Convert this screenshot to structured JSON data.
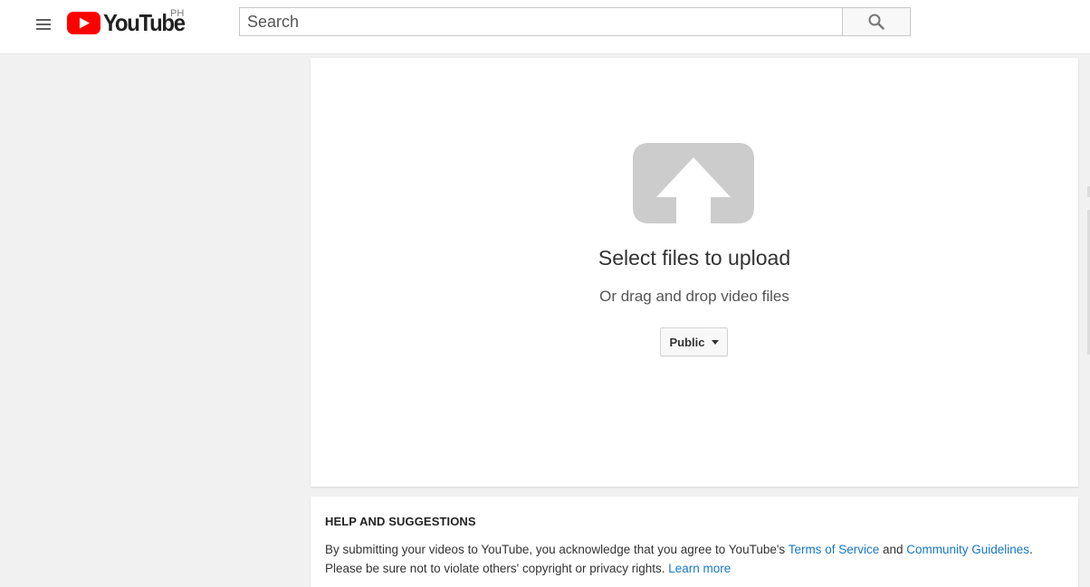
{
  "header": {
    "logo_text": "YouTube",
    "logo_region": "PH",
    "search_placeholder": "Search"
  },
  "upload": {
    "title": "Select files to upload",
    "subtitle": "Or drag and drop video files",
    "privacy_label": "Public"
  },
  "help": {
    "title": "HELP AND SUGGESTIONS",
    "line1_prefix": "By submitting your videos to YouTube, you acknowledge that you agree to YouTube's ",
    "terms_link": "Terms of Service",
    "line1_and": " and ",
    "guidelines_link": "Community Guidelines",
    "line1_end": ".",
    "line2_prefix": "Please be sure not to violate others' copyright or privacy rights. ",
    "learn_more_link": "Learn more"
  },
  "colors": {
    "brand_red": "#ff0000",
    "link_blue": "#167ac6",
    "upload_icon_gray": "#cccccc",
    "page_background": "#f1f1f1"
  },
  "icons": {
    "menu": "hamburger-icon",
    "search": "search-icon",
    "upload": "upload-arrow-icon",
    "dropdown": "caret-down-icon"
  }
}
